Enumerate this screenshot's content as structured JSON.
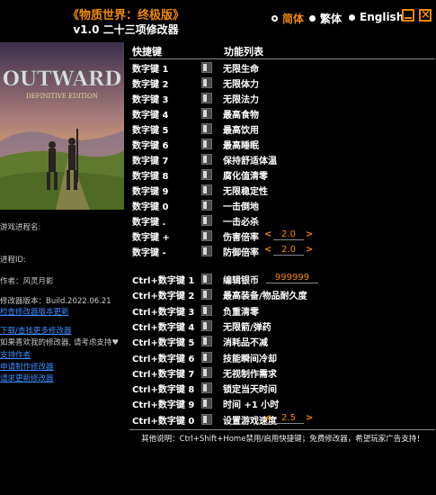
{
  "header": {
    "title": "《物质世界：终极版》",
    "subtitle": "v1.0 二十三项修改器"
  },
  "languages": [
    {
      "label": "简体",
      "selected": true
    },
    {
      "label": "繁体",
      "selected": false
    },
    {
      "label": "English",
      "selected": false
    }
  ],
  "cover": {
    "logo": "OUTWARD",
    "edition": "DEFINITIVE EDITION"
  },
  "sidebar": {
    "process_name_label": "游戏进程名:",
    "process_id_label": "进程ID:",
    "author": "作者：风灵月影",
    "version": "修改器版本：Build.2022.06.21",
    "check_update": "检查修改器版本更新",
    "download_more": "下载/查找更多修改器",
    "support_text": "如果喜欢我的修改器, 请考虑支持♥",
    "support_author": "支持作者",
    "request_trainer": "申请制作修改器",
    "request_update": "请求更新修改器"
  },
  "table": {
    "col_hotkey": "快捷键",
    "col_function": "功能列表",
    "rows": [
      {
        "key": "数字键 1",
        "label": "无限生命"
      },
      {
        "key": "数字键 2",
        "label": "无限体力"
      },
      {
        "key": "数字键 3",
        "label": "无限法力"
      },
      {
        "key": "数字键 4",
        "label": "最高食物"
      },
      {
        "key": "数字键 5",
        "label": "最高饮用"
      },
      {
        "key": "数字键 6",
        "label": "最高睡眠"
      },
      {
        "key": "数字键 7",
        "label": "保持舒适体温"
      },
      {
        "key": "数字键 8",
        "label": "腐化值清零"
      },
      {
        "key": "数字键 9",
        "label": "无限稳定性"
      },
      {
        "key": "数字键 0",
        "label": "一击倒地"
      },
      {
        "key": "数字键 .",
        "label": "一击必杀"
      },
      {
        "key": "数字键 +",
        "label": "伤害倍率",
        "value": "2.0"
      },
      {
        "key": "数字键 -",
        "label": "防御倍率",
        "value": "2.0"
      }
    ],
    "rows2": [
      {
        "key": "Ctrl+数字键 1",
        "label": "编辑银币",
        "money": "999999"
      },
      {
        "key": "Ctrl+数字键 2",
        "label": "最高装备/物品耐久度"
      },
      {
        "key": "Ctrl+数字键 3",
        "label": "负重清零"
      },
      {
        "key": "Ctrl+数字键 4",
        "label": "无限箭/弹药"
      },
      {
        "key": "Ctrl+数字键 5",
        "label": "消耗品不减"
      },
      {
        "key": "Ctrl+数字键 6",
        "label": "技能瞬间冷却"
      },
      {
        "key": "Ctrl+数字键 7",
        "label": "无视制作需求"
      },
      {
        "key": "Ctrl+数字键 8",
        "label": "锁定当天时间"
      },
      {
        "key": "Ctrl+数字键 9",
        "label": "时间 +1 小时"
      },
      {
        "key": "Ctrl+数字键 0",
        "label": "设置游戏速度",
        "value": "2.5"
      }
    ]
  },
  "arrows": {
    "left": "<",
    "right": ">"
  },
  "footer": "其他说明：Ctrl+Shift+Home禁用/启用快捷键；免费修改器，希望玩家广告支持！"
}
